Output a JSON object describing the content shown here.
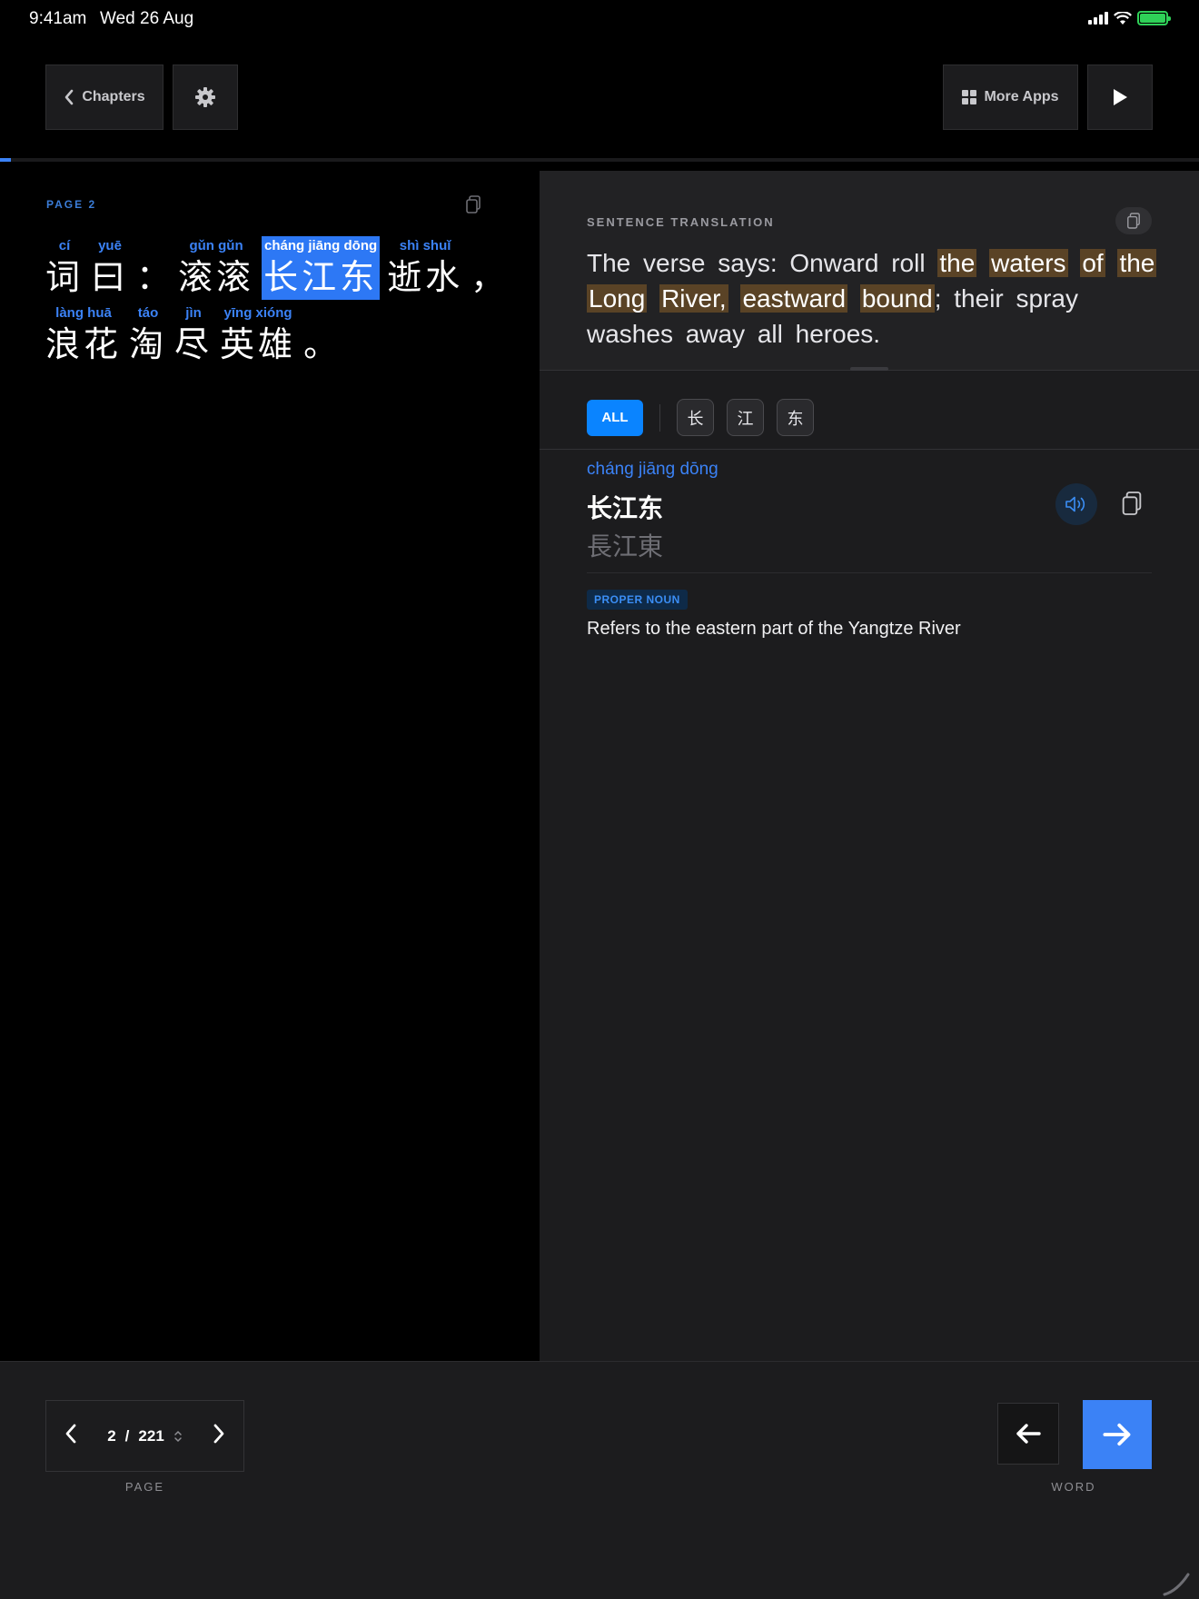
{
  "status_bar": {
    "time": "9:41am",
    "date": "Wed 26 Aug"
  },
  "toolbar": {
    "chapters_label": "Chapters",
    "more_apps_label": "More Apps"
  },
  "progress": {
    "fraction": 0.009
  },
  "reading": {
    "page_label": "PAGE  2",
    "lines": [
      [
        {
          "pinyin": "cí",
          "hanzi": "词"
        },
        {
          "pinyin": "yuē",
          "hanzi": "曰"
        },
        {
          "pinyin": "",
          "hanzi": "："
        },
        {
          "pinyin": "gǔn gǔn",
          "hanzi": "滚滚"
        },
        {
          "pinyin": "cháng jiāng dōng",
          "hanzi": "长江东",
          "active": true
        },
        {
          "pinyin": "shì shuǐ",
          "hanzi": "逝水"
        },
        {
          "pinyin": "",
          "hanzi": "，"
        }
      ],
      [
        {
          "pinyin": "làng huā",
          "hanzi": "浪花"
        },
        {
          "pinyin": "táo",
          "hanzi": "淘"
        },
        {
          "pinyin": "jìn",
          "hanzi": "尽"
        },
        {
          "pinyin": "yīng xióng",
          "hanzi": "英雄"
        },
        {
          "pinyin": "",
          "hanzi": "。"
        }
      ]
    ]
  },
  "translation": {
    "label": "SENTENCE TRANSLATION",
    "before": "The verse says: Onward roll ",
    "highlighted": [
      "the",
      "waters",
      "of",
      "the",
      "Long",
      "River,",
      "eastward",
      "bound"
    ],
    "after": "; their spray washes away all heroes."
  },
  "filters": {
    "all_label": "ALL",
    "chars": [
      "长",
      "江",
      "东"
    ]
  },
  "word": {
    "pinyin": "cháng jiāng dōng",
    "simplified": "长江东",
    "traditional": "長江東",
    "pos": "PROPER NOUN",
    "definition": "Refers to the eastern part of the Yangtze River"
  },
  "pager": {
    "current": "2",
    "separator": "/",
    "total": "221",
    "caption": "PAGE"
  },
  "word_nav": {
    "caption": "WORD"
  },
  "colors": {
    "accent": "#3b82f6",
    "highlight": "#5a4326",
    "panel": "#1c1c1e"
  }
}
